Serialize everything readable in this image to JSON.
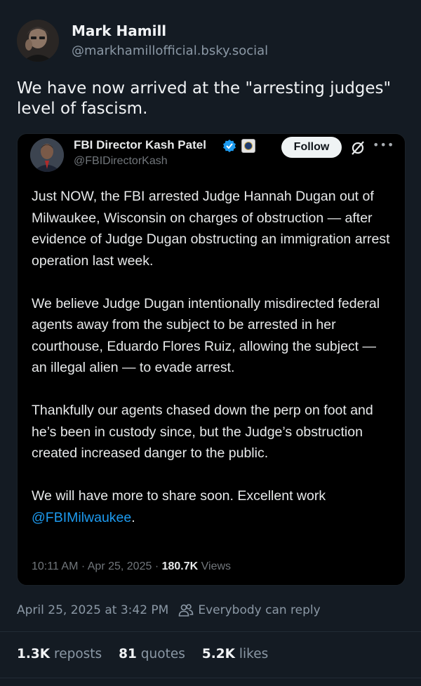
{
  "author": {
    "name": "Mark Hamill",
    "handle": "@markhamillofficial.bsky.social"
  },
  "post_text": "We have now arrived at the \"arresting judges\" level of fascism.",
  "embed": {
    "name": "FBI Director Kash Patel",
    "handle": "@FBIDirectorKash",
    "follow_label": "Follow",
    "more_label": "•••",
    "paragraphs": [
      "Just NOW, the FBI arrested Judge Hannah Dugan out of Milwaukee, Wisconsin on charges of obstruction — after evidence of Judge Dugan obstructing an immigration arrest operation last week.",
      "We believe Judge Dugan intentionally misdirected federal agents away from the subject to be arrested in her courthouse, Eduardo Flores Ruiz, allowing the subject — an illegal alien — to evade arrest.",
      "Thankfully our agents chased down the perp on foot and he’s been in custody since, but the Judge’s obstruction created increased danger to the public."
    ],
    "last_paragraph_text": "We will have more to share soon. Excellent work ",
    "mention": "@FBIMilwaukee",
    "last_paragraph_end": ".",
    "timestamp": "10:11 AM · Apr 25, 2025 · ",
    "views_count": "180.7K",
    "views_label": " Views"
  },
  "meta": {
    "datetime": "April 25, 2025 at 3:42 PM",
    "reply_setting": "Everybody can reply"
  },
  "stats": {
    "reposts_count": "1.3K",
    "reposts_label": " reposts",
    "quotes_count": "81",
    "quotes_label": " quotes",
    "likes_count": "5.2K",
    "likes_label": " likes"
  },
  "colors": {
    "background": "#141b23",
    "embed_background": "#000000",
    "link": "#1d9bf0",
    "verified": "#1d9bf0",
    "muted": "#8b98a5"
  },
  "icons": [
    "people-icon",
    "verified-badge-icon",
    "fbi-seal-icon",
    "grok-icon",
    "more-icon"
  ]
}
